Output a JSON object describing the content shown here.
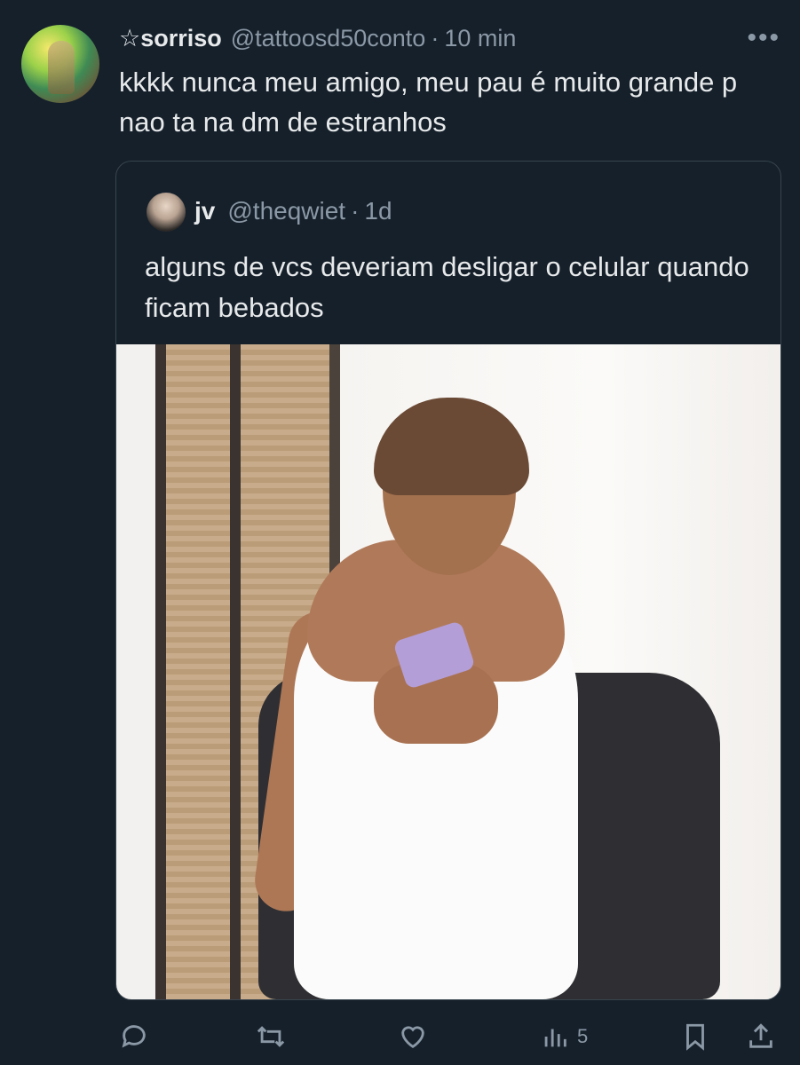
{
  "tweet": {
    "display_name": "☆sorriso",
    "handle": "@tattoosd50conto",
    "separator": "·",
    "time": "10 min",
    "text": "kkkk nunca meu amigo, meu pau é muito grande p nao ta na dm de estranhos",
    "more_label": "•••"
  },
  "quote": {
    "display_name": "jv",
    "handle": "@theqwiet",
    "separator": "·",
    "time": "1d",
    "text": "alguns de vcs deveriam desligar o celular quando ficam bebados"
  },
  "actions": {
    "reply_icon": "reply-icon",
    "retweet_icon": "retweet-icon",
    "like_icon": "heart-icon",
    "views_icon": "views-icon",
    "views_count": "5",
    "bookmark_icon": "bookmark-icon",
    "share_icon": "share-icon"
  },
  "colors": {
    "background": "#15202b",
    "text": "#e7e9ea",
    "muted": "#8b98a5",
    "border": "#38444d"
  }
}
